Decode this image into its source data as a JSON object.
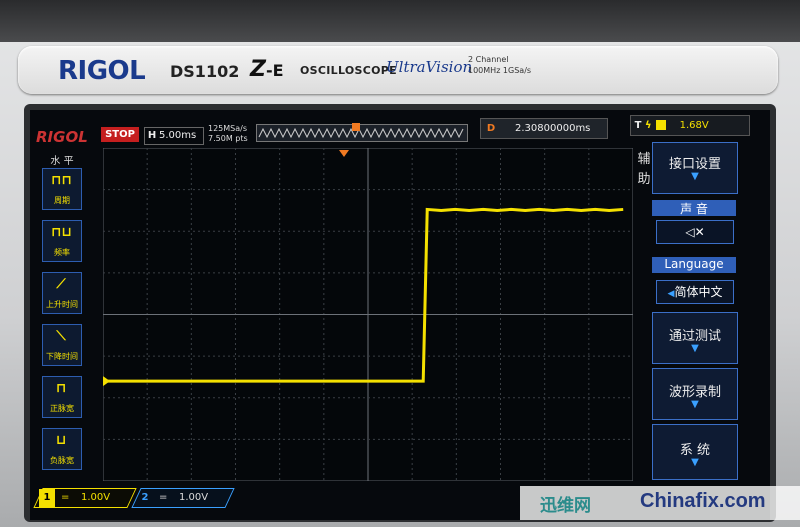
{
  "faceplate": {
    "brand": "RIGOL",
    "model": "DS1102",
    "series_mark": "Z",
    "series_suffix": "-E",
    "type_label": "OSCILLOSCOPE",
    "ultravision": "UltraVision",
    "spec_line1": "2 Channel",
    "spec_line2": "100MHz  1GSa/s"
  },
  "screen": {
    "logo": "RIGOL",
    "run_state": "STOP",
    "timebase_label": "H",
    "timebase_value": "5.00ms",
    "sample_rate": "125MSa/s",
    "mem_depth": "7.50M pts",
    "delay_label": "D",
    "delay_value": "2.30800000ms",
    "trigger_label": "T",
    "trigger_level": "1.68V"
  },
  "left_menu": {
    "title": "水 平",
    "items": [
      {
        "label": "周期",
        "glyph": "⊓⊓"
      },
      {
        "label": "频率",
        "glyph": "⊓⊔"
      },
      {
        "label": "上升时间",
        "glyph": "⟋"
      },
      {
        "label": "下降时间",
        "glyph": "⟍"
      },
      {
        "label": "正脉宽",
        "glyph": "⊓"
      },
      {
        "label": "负脉宽",
        "glyph": "⊔"
      }
    ]
  },
  "right_menu": {
    "side_label": "辅助",
    "interface": "接口设置",
    "sound_head": "声 音",
    "sound_icon": "🔈",
    "language_head": "Language",
    "language_value": "简体中文",
    "pass_fail": "通过测试",
    "record": "波形录制",
    "system": "系 统"
  },
  "channels": {
    "ch1_num": "1",
    "ch1_scale": "1.00V",
    "ch2_num": "2",
    "ch2_scale": "1.00V"
  },
  "waveform": {
    "ch1_color": "#f4e000",
    "low_level_div": -1.6,
    "high_level_div": 2.5,
    "edge_time_div": 1.8
  },
  "watermark": {
    "cn": "迅维网",
    "en": "Chinafix.com"
  },
  "colors": {
    "accent_blue": "#2f5fb8",
    "trigger_orange": "#f07a22",
    "stop_red": "#c51f1f"
  }
}
